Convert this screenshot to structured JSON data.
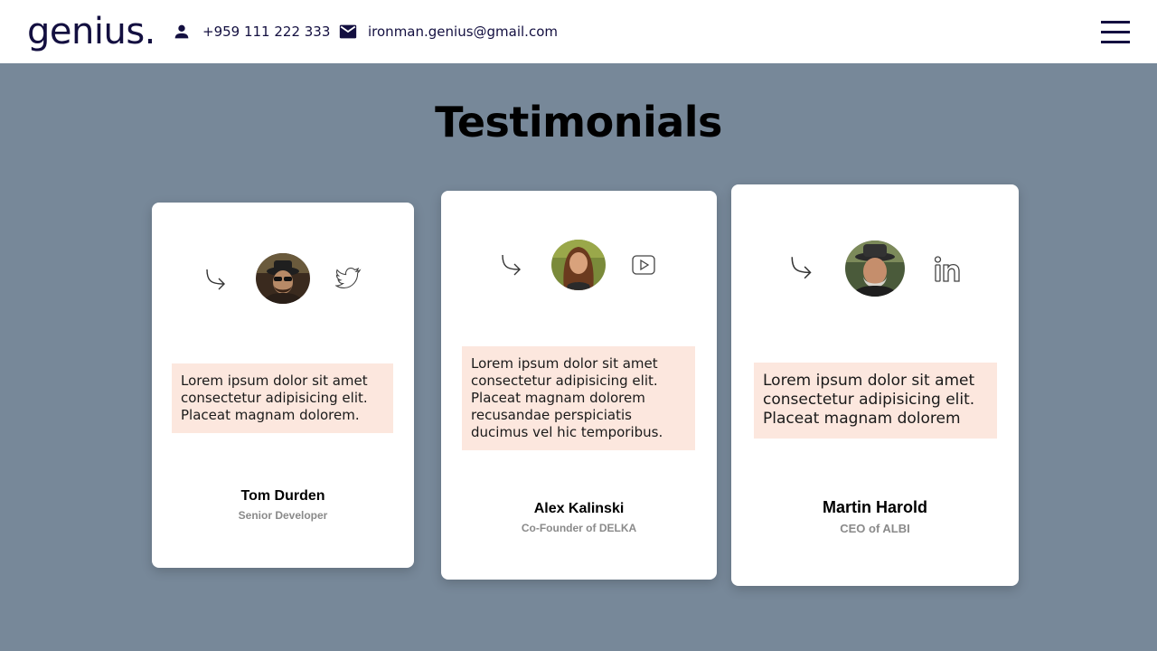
{
  "header": {
    "logo": "genius.",
    "phone": "+959 111 222 333",
    "email": "ironman.genius@gmail.com",
    "phone_icon": "person-icon",
    "email_icon": "mail-icon",
    "menu_icon": "hamburger-menu-icon"
  },
  "main": {
    "title": "Testimonials"
  },
  "testimonials": [
    {
      "name": "Tom Durden",
      "role": "Senior Developer",
      "quote": "Lorem ipsum dolor sit amet consectetur adipisicing elit. Placeat magnam dolorem.",
      "social_icon": "twitter-icon",
      "arrow_icon": "arrow-curve-right-icon"
    },
    {
      "name": "Alex Kalinski",
      "role": "Co-Founder of DELKA",
      "quote": "Lorem ipsum dolor sit amet consectetur adipisicing elit. Placeat magnam dolorem recusandae perspiciatis ducimus vel hic temporibus.",
      "social_icon": "youtube-icon",
      "arrow_icon": "arrow-curve-right-icon"
    },
    {
      "name": "Martin Harold",
      "role": "CEO of ALBI",
      "quote": "Lorem ipsum dolor sit amet consectetur adipisicing elit. Placeat magnam dolorem",
      "social_icon": "linkedin-icon",
      "arrow_icon": "arrow-curve-right-icon"
    }
  ],
  "colors": {
    "background": "#778899",
    "brand": "#130f40",
    "quote_bg": "#fce7de",
    "card": "#ffffff"
  }
}
